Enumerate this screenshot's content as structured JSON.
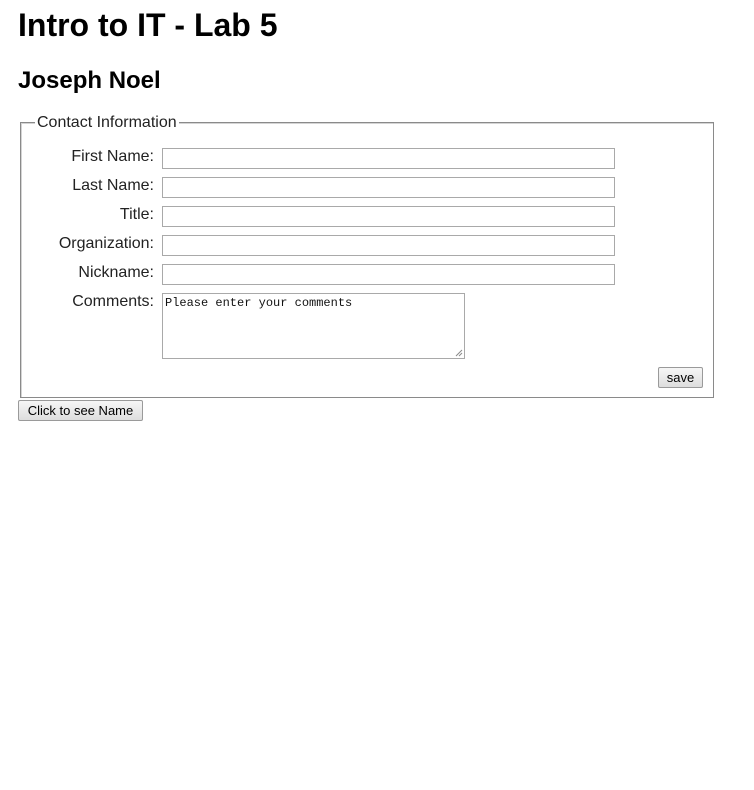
{
  "page": {
    "title": "Intro to IT - Lab 5",
    "author": "Joseph Noel"
  },
  "form": {
    "legend": "Contact Information",
    "fields": [
      {
        "label": "First Name:",
        "value": ""
      },
      {
        "label": "Last Name:",
        "value": ""
      },
      {
        "label": "Title:",
        "value": ""
      },
      {
        "label": "Organization:",
        "value": ""
      },
      {
        "label": "Nickname:",
        "value": ""
      }
    ],
    "comments": {
      "label": "Comments:",
      "value": "Please enter your comments"
    },
    "save_label": "save"
  },
  "actions": {
    "see_name_label": "Click to see Name"
  }
}
